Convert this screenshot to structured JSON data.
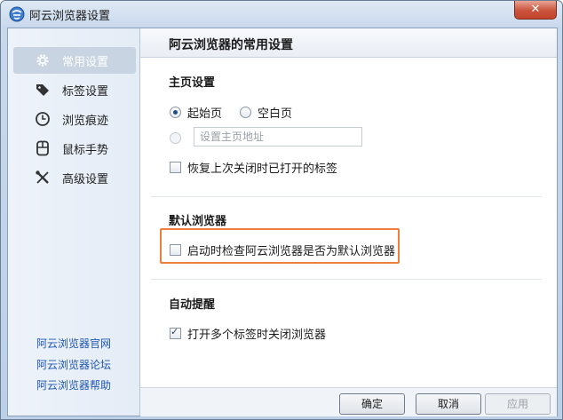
{
  "window": {
    "title": "阿云浏览器设置",
    "close_glyph": "✕",
    "app_icon": "browser-logo-icon"
  },
  "sidebar": {
    "items": [
      {
        "label": "常用设置",
        "icon": "gear-icon",
        "active": true
      },
      {
        "label": "标签设置",
        "icon": "tag-icon",
        "active": false
      },
      {
        "label": "浏览痕迹",
        "icon": "clock-icon",
        "active": false
      },
      {
        "label": "鼠标手势",
        "icon": "mouse-icon",
        "active": false
      },
      {
        "label": "高级设置",
        "icon": "tools-icon",
        "active": false
      }
    ],
    "links": [
      "阿云浏览器官网",
      "阿云浏览器论坛",
      "阿云浏览器帮助"
    ]
  },
  "main": {
    "title": "阿云浏览器的常用设置",
    "homepage": {
      "heading": "主页设置",
      "radio_start": "起始页",
      "radio_blank": "空白页",
      "custom_placeholder": "设置主页地址",
      "restore_tabs": "恢复上次关闭时已打开的标签"
    },
    "default_browser": {
      "heading": "默认浏览器",
      "check_default": "启动时检查阿云浏览器是否为默认浏览器"
    },
    "auto_remind": {
      "heading": "自动提醒",
      "close_multi_tabs": "打开多个标签时关闭浏览器"
    }
  },
  "footer": {
    "ok": "确定",
    "cancel": "取消",
    "apply": "应用"
  },
  "colors": {
    "highlight": "#ef7d3c",
    "link": "#1f56b0",
    "active_nav": "#c9d4e2"
  }
}
